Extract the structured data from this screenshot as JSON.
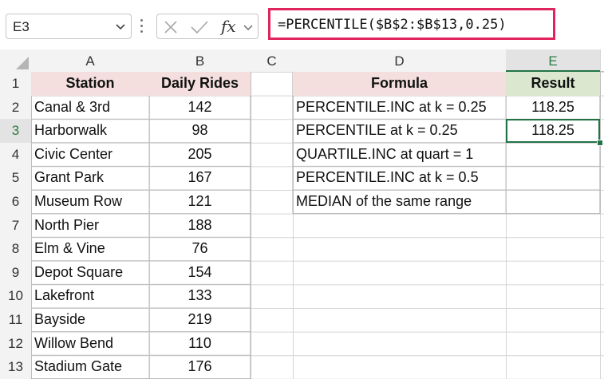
{
  "formula_bar": {
    "name_box": "E3",
    "fx_label": "fx",
    "formula": "=PERCENTILE($B$2:$B$13,0.25)"
  },
  "sheet": {
    "columns": [
      "A",
      "B",
      "C",
      "D",
      "E"
    ],
    "rows": [
      "1",
      "2",
      "3",
      "4",
      "5",
      "6",
      "7",
      "8",
      "9",
      "10",
      "11",
      "12",
      "13"
    ],
    "station_header": "Station",
    "rides_header": "Daily Rides",
    "stations": [
      {
        "name": "Canal & 3rd",
        "rides": "142"
      },
      {
        "name": "Harborwalk",
        "rides": "98"
      },
      {
        "name": "Civic Center",
        "rides": "205"
      },
      {
        "name": "Grant Park",
        "rides": "167"
      },
      {
        "name": "Museum Row",
        "rides": "121"
      },
      {
        "name": "North Pier",
        "rides": "188"
      },
      {
        "name": "Elm & Vine",
        "rides": "76"
      },
      {
        "name": "Depot Square",
        "rides": "154"
      },
      {
        "name": "Lakefront",
        "rides": "133"
      },
      {
        "name": "Bayside",
        "rides": "219"
      },
      {
        "name": "Willow Bend",
        "rides": "110"
      },
      {
        "name": "Stadium Gate",
        "rides": "176"
      }
    ],
    "formula_header": "Formula",
    "result_header": "Result",
    "formulas": [
      {
        "label": "PERCENTILE.INC at k = 0.25",
        "result": "118.25"
      },
      {
        "label": "PERCENTILE at k = 0.25",
        "result": "118.25"
      },
      {
        "label": "QUARTILE.INC at quart = 1",
        "result": ""
      },
      {
        "label": "PERCENTILE.INC at k = 0.5",
        "result": ""
      },
      {
        "label": "MEDIAN of the same range",
        "result": ""
      }
    ]
  },
  "colors": {
    "accent_green": "#217346",
    "highlight_red": "#e0245e",
    "header_pink": "#f4dede",
    "header_green": "#dbe8cf"
  }
}
